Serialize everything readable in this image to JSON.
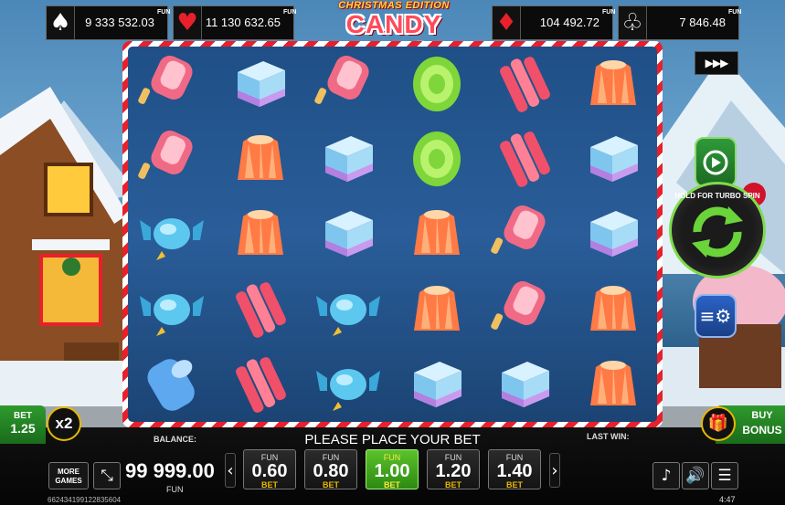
{
  "jackpots": [
    {
      "suit": "♠",
      "suit_color": "#ffffff",
      "amount": "9 333 532.03",
      "tag": "FUN"
    },
    {
      "suit": "♥",
      "suit_color": "#e8202b",
      "amount": "11 130 632.65",
      "tag": "FUN"
    },
    {
      "suit": "♦",
      "suit_color": "#e8202b",
      "amount": "104 492.72",
      "tag": "FUN"
    },
    {
      "suit": "♧",
      "suit_color": "#ffffff",
      "amount": "7 846.48",
      "tag": "FUN"
    }
  ],
  "logo": {
    "subtitle": "CHRISTMAS EDITION",
    "title": "CANDY PALACE"
  },
  "reels": [
    [
      "popsicle",
      "cube",
      "popsicle",
      "swirl",
      "ribbon",
      "jelly"
    ],
    [
      "popsicle",
      "jelly",
      "cube",
      "swirl",
      "ribbon",
      "cube"
    ],
    [
      "wrapped",
      "jelly",
      "cube",
      "jelly",
      "popsicle",
      "cube"
    ],
    [
      "wrapped",
      "ribbon",
      "wrapped",
      "jelly",
      "popsicle",
      "jelly"
    ],
    [
      "roll",
      "ribbon",
      "wrapped",
      "cube",
      "cube",
      "jelly"
    ]
  ],
  "speed": {
    "label": "▶▶▶",
    "icon": "fast-forward-icon"
  },
  "turbo": {
    "label": "HOLD FOR TURBO SPIN",
    "icon": "spin-arrows-icon"
  },
  "bet": {
    "label": "BET",
    "value": "1.25"
  },
  "multiplier": {
    "label": "x2"
  },
  "buy_bonus": {
    "label1": "BUY",
    "label2": "BONUS",
    "icon": "gift-icon"
  },
  "message": "PLEASE PLACE YOUR BET",
  "balance": {
    "label": "BALANCE:",
    "value": "99 999.00",
    "currency": "FUN"
  },
  "last_win": {
    "label": "LAST WIN:"
  },
  "more_games": {
    "line1": "MORE",
    "line2": "GAMES"
  },
  "bet_options": [
    {
      "fun": "FUN",
      "value": "0.60",
      "bet": "BET",
      "selected": false
    },
    {
      "fun": "FUN",
      "value": "0.80",
      "bet": "BET",
      "selected": false
    },
    {
      "fun": "FUN",
      "value": "1.00",
      "bet": "BET",
      "selected": true
    },
    {
      "fun": "FUN",
      "value": "1.20",
      "bet": "BET",
      "selected": false
    },
    {
      "fun": "FUN",
      "value": "1.40",
      "bet": "BET",
      "selected": false
    }
  ],
  "session_id": "662434199122835604",
  "time": "4:47",
  "colors": {
    "accent_green": "#3aa63a",
    "highlight_yellow": "#e8b800",
    "frame_red": "#e8202b"
  }
}
